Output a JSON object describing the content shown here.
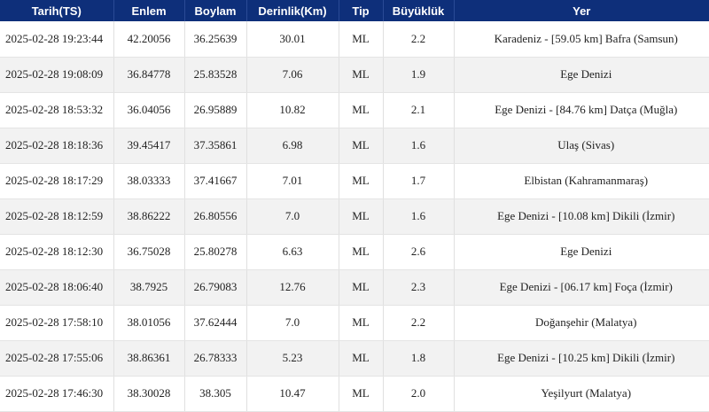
{
  "table": {
    "headers": {
      "date": "Tarih(TS)",
      "lat": "Enlem",
      "lon": "Boylam",
      "depth": "Derinlik(Km)",
      "type": "Tip",
      "mag": "Büyüklük",
      "place": "Yer"
    },
    "rows": [
      {
        "date": "2025-02-28 19:23:44",
        "lat": "42.20056",
        "lon": "36.25639",
        "depth": "30.01",
        "type": "ML",
        "mag": "2.2",
        "place": "Karadeniz - [59.05 km] Bafra (Samsun)"
      },
      {
        "date": "2025-02-28 19:08:09",
        "lat": "36.84778",
        "lon": "25.83528",
        "depth": "7.06",
        "type": "ML",
        "mag": "1.9",
        "place": "Ege Denizi"
      },
      {
        "date": "2025-02-28 18:53:32",
        "lat": "36.04056",
        "lon": "26.95889",
        "depth": "10.82",
        "type": "ML",
        "mag": "2.1",
        "place": "Ege Denizi - [84.76 km] Datça (Muğla)"
      },
      {
        "date": "2025-02-28 18:18:36",
        "lat": "39.45417",
        "lon": "37.35861",
        "depth": "6.98",
        "type": "ML",
        "mag": "1.6",
        "place": "Ulaş (Sivas)"
      },
      {
        "date": "2025-02-28 18:17:29",
        "lat": "38.03333",
        "lon": "37.41667",
        "depth": "7.01",
        "type": "ML",
        "mag": "1.7",
        "place": "Elbistan (Kahramanmaraş)"
      },
      {
        "date": "2025-02-28 18:12:59",
        "lat": "38.86222",
        "lon": "26.80556",
        "depth": "7.0",
        "type": "ML",
        "mag": "1.6",
        "place": "Ege Denizi - [10.08 km] Dikili (İzmir)"
      },
      {
        "date": "2025-02-28 18:12:30",
        "lat": "36.75028",
        "lon": "25.80278",
        "depth": "6.63",
        "type": "ML",
        "mag": "2.6",
        "place": "Ege Denizi"
      },
      {
        "date": "2025-02-28 18:06:40",
        "lat": "38.7925",
        "lon": "26.79083",
        "depth": "12.76",
        "type": "ML",
        "mag": "2.3",
        "place": "Ege Denizi - [06.17 km] Foça (İzmir)"
      },
      {
        "date": "2025-02-28 17:58:10",
        "lat": "38.01056",
        "lon": "37.62444",
        "depth": "7.0",
        "type": "ML",
        "mag": "2.2",
        "place": "Doğanşehir (Malatya)"
      },
      {
        "date": "2025-02-28 17:55:06",
        "lat": "38.86361",
        "lon": "26.78333",
        "depth": "5.23",
        "type": "ML",
        "mag": "1.8",
        "place": "Ege Denizi - [10.25 km] Dikili (İzmir)"
      },
      {
        "date": "2025-02-28 17:46:30",
        "lat": "38.30028",
        "lon": "38.305",
        "depth": "10.47",
        "type": "ML",
        "mag": "2.0",
        "place": "Yeşilyurt (Malatya)"
      }
    ]
  },
  "colors": {
    "header_bg": "#0e2f7a",
    "header_text": "#ffffff",
    "row_alt_bg": "#f2f2f2"
  }
}
